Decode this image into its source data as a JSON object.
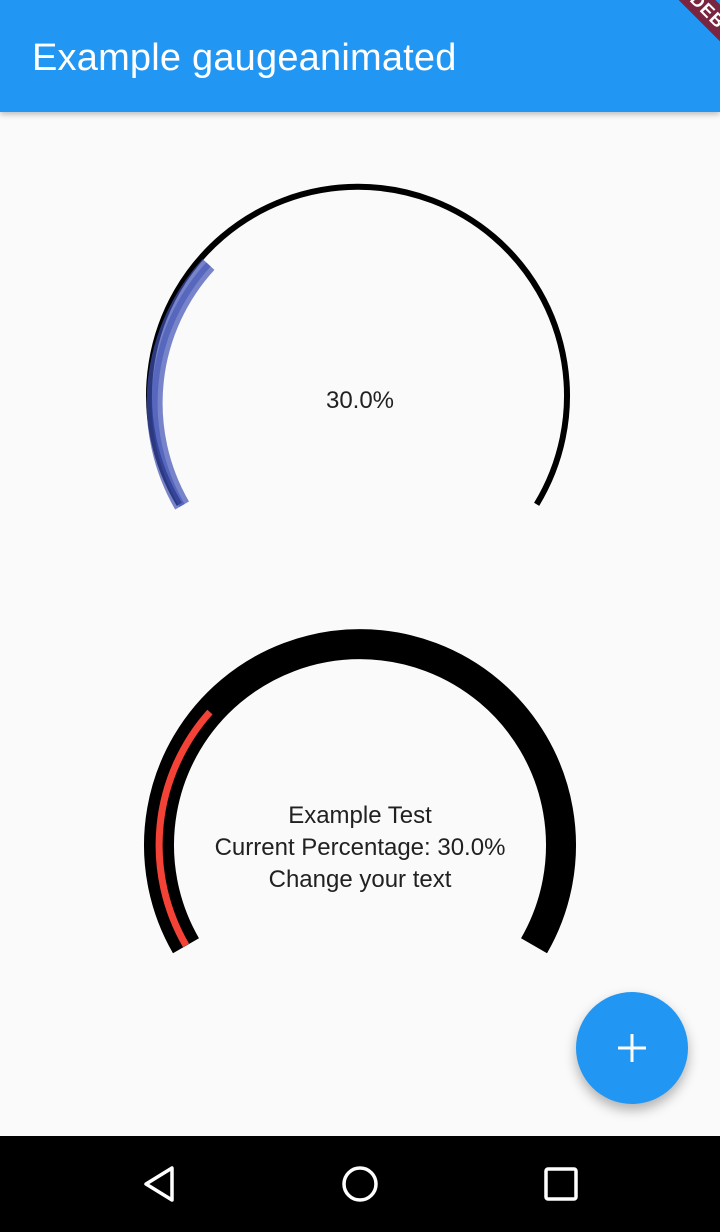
{
  "app_bar": {
    "title": "Example gaugeanimated",
    "background_color": "#2196f3"
  },
  "debug_banner": {
    "label": "DEBUG"
  },
  "gauge_1": {
    "label": "30.0%",
    "value_percent": 30.0,
    "track_color": "#000000",
    "progress_color": "#3f51b5"
  },
  "gauge_2": {
    "lines": [
      "Example Test",
      "Current Percentage: 30.0%",
      "Change your text"
    ],
    "value_percent": 30.0,
    "track_color": "#000000",
    "progress_color": "#f44336"
  },
  "fab": {
    "icon": "plus-icon",
    "background_color": "#2196f3"
  },
  "system_nav": {
    "back_icon": "back-triangle-icon",
    "home_icon": "home-circle-icon",
    "recents_icon": "recents-square-icon"
  }
}
